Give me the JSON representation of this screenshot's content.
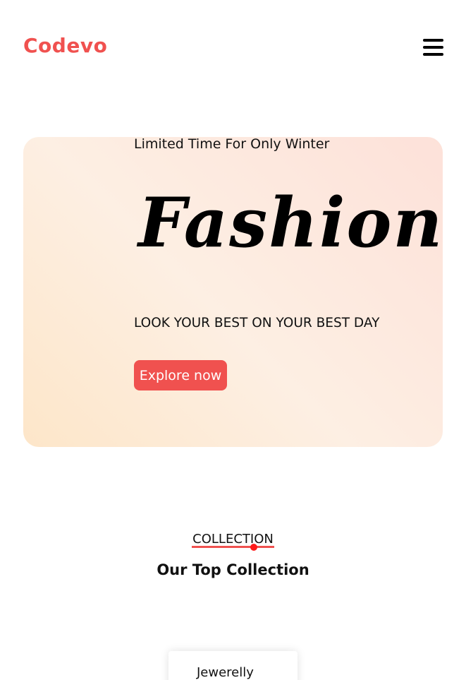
{
  "header": {
    "logo_text": "Codevo",
    "menu_icon": "hamburger-icon"
  },
  "hero": {
    "subtitle": "Limited Time For Only Winter",
    "title": "Fashion",
    "tagline": "LOOK YOUR BEST ON YOUR BEST DAY",
    "cta_label": "Explore now"
  },
  "collection": {
    "label": "COLLECTION",
    "title": "Our Top Collection",
    "cards": [
      {
        "label": "Jewerelly"
      }
    ]
  },
  "colors": {
    "accent": "#f0514f",
    "dot": "#ff1a1a"
  }
}
